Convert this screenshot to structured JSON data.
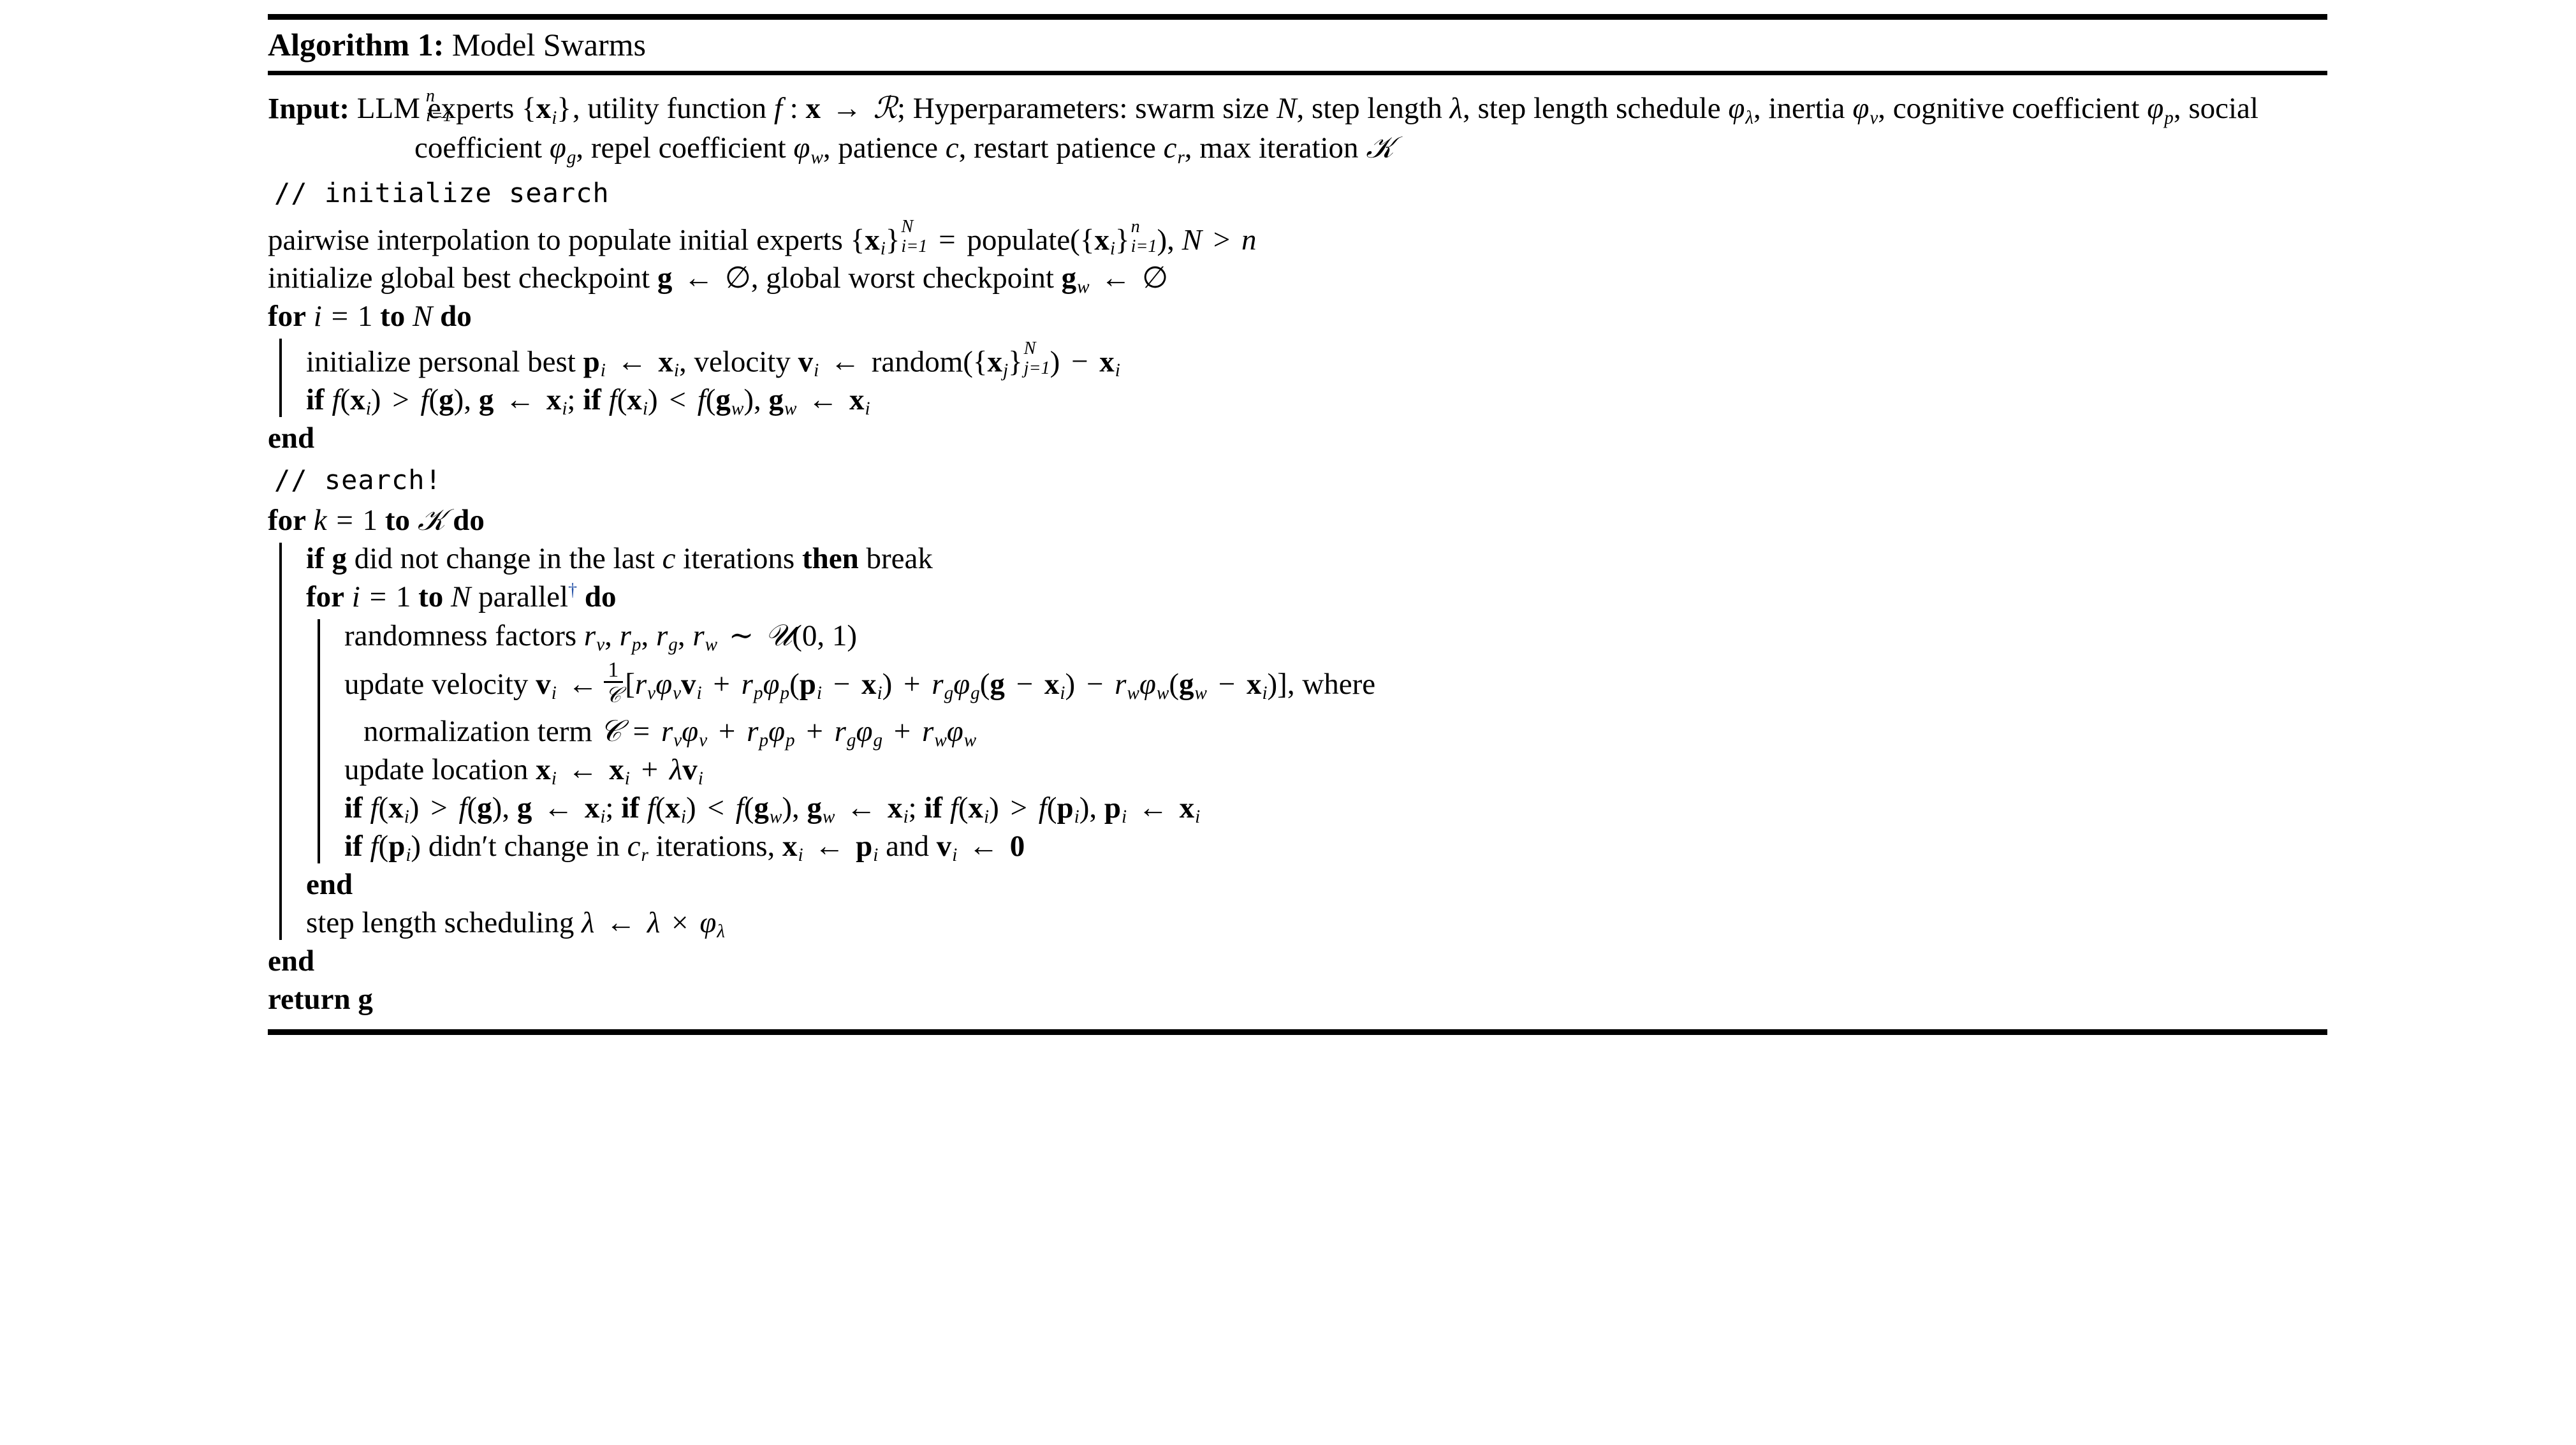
{
  "caption": {
    "label": "Algorithm 1:",
    "title": "Model Swarms"
  },
  "input": {
    "label": "Input:",
    "text_1": "LLM experts {x",
    "text_2": ", utility function f : x → ℛ; Hyperparameters: swarm size N, step length",
    "text_3": "λ, step length schedule φ",
    "text_4": ", inertia φ",
    "text_5": ", cognitive coefficient φ",
    "text_6": ", social coefficient φ",
    "text_7": ", repel",
    "text_8": "coefficient φ",
    "text_9": ", patience c, restart patience c",
    "text_10": ", max iteration 𝒦"
  },
  "comments": {
    "initialize": "// initialize search",
    "search": "// search!"
  },
  "lines": {
    "populate": "pairwise interpolation to populate initial experts {x",
    "populate_2": "= populate({x",
    "populate_3": "), N > n",
    "init_global": "initialize global best checkpoint g ← ∅, global worst checkpoint g",
    "init_global_2": "← ∅",
    "for_i_n": {
      "kw_for": "for",
      "var": "i",
      "eq": "= 1",
      "kw_to": "to",
      "bound": "N",
      "kw_do": "do"
    },
    "init_personal": "initialize personal best p",
    "init_personal_2": "← x",
    "init_personal_3": ", velocity v",
    "init_personal_4": "← random({x",
    "init_personal_5": ") − x",
    "if_update_1": "if",
    "end_1": "end",
    "for_k_K": {
      "kw_for": "for",
      "var": "k",
      "eq": "= 1",
      "kw_to": "to",
      "bound": "𝒦",
      "kw_do": "do"
    },
    "if_no_change": {
      "kw_if": "if",
      "g": "g",
      "text": "did not change in the last",
      "c": "c",
      "text2": "iterations",
      "kw_then": "then",
      "brk": "break"
    },
    "for_parallel": {
      "kw_for": "for",
      "var": "i",
      "eq": "= 1",
      "kw_to": "to",
      "bound": "N",
      "parallel": "parallel",
      "dagger": "†",
      "kw_do": "do"
    },
    "randomness": "randomness factors r",
    "randomness_2": ", r",
    "randomness_3": "∼ 𝒰(0, 1)",
    "update_velocity": "update velocity v",
    "update_velocity_arrow": "←",
    "where": ", where",
    "normalization": "normalization term 𝒞 = r",
    "update_location": "update location x",
    "update_location_2": "← x",
    "update_location_3": "+ λv",
    "if_pi_1": "if",
    "didnt_change": "didn′t change in",
    "iterations": "iterations,",
    "and": "and",
    "end_2": "end",
    "step_schedule": "step length scheduling λ ← λ × φ",
    "end_3": "end",
    "return": "return g"
  },
  "keywords": {
    "for": "for",
    "to": "to",
    "do": "do",
    "if": "if",
    "then": "then",
    "end": "end",
    "return": "return",
    "break": "break"
  },
  "symbols": {
    "arrow_left": "←",
    "empty_set": "∅",
    "dagger": "†",
    "lambda": "λ",
    "phi": "φ",
    "sim": "∼",
    "times": "×",
    "to_arrow": "→",
    "minus": "−",
    "plus": "+",
    "gt": ">",
    "lt": "<",
    "eq": "=",
    "cal_K": "𝒦",
    "cal_U": "𝒰",
    "cal_C": "𝒞",
    "cal_R": "ℛ"
  },
  "colors": {
    "text": "#000000",
    "rule": "#000000",
    "footnote_mark": "#2451a6",
    "background": "#ffffff"
  }
}
